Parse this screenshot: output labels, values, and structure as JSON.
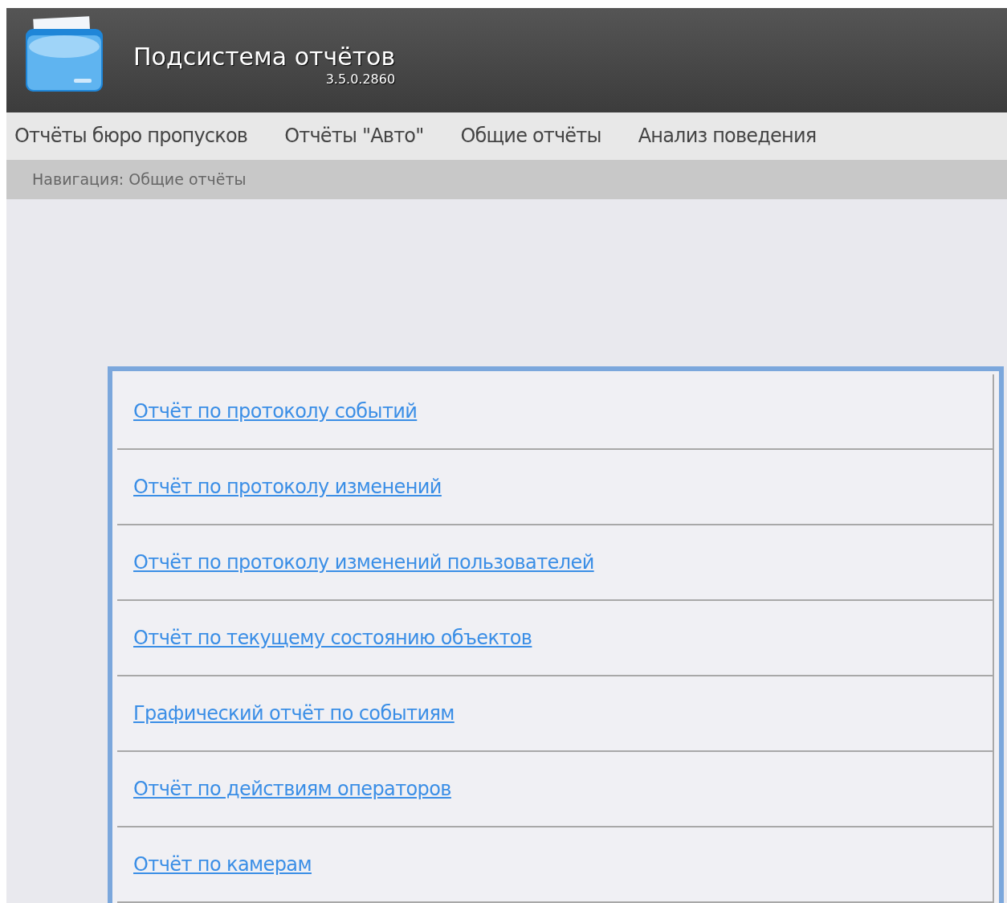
{
  "header": {
    "title": "Подсистема отчётов",
    "version": "3.5.0.2860"
  },
  "menu": [
    "Отчёты бюро пропусков",
    "Отчёты \"Авто\"",
    "Общие отчёты",
    "Анализ поведения"
  ],
  "breadcrumb": "Навигация: Общие отчёты",
  "reports": [
    "Отчёт по протоколу событий",
    "Отчёт по протоколу изменений",
    "Отчёт по протоколу изменений пользователей",
    "Отчёт по текущему состоянию объектов",
    "Графический отчёт по событиям",
    "Отчёт по действиям операторов",
    "Отчёт по камерам"
  ]
}
